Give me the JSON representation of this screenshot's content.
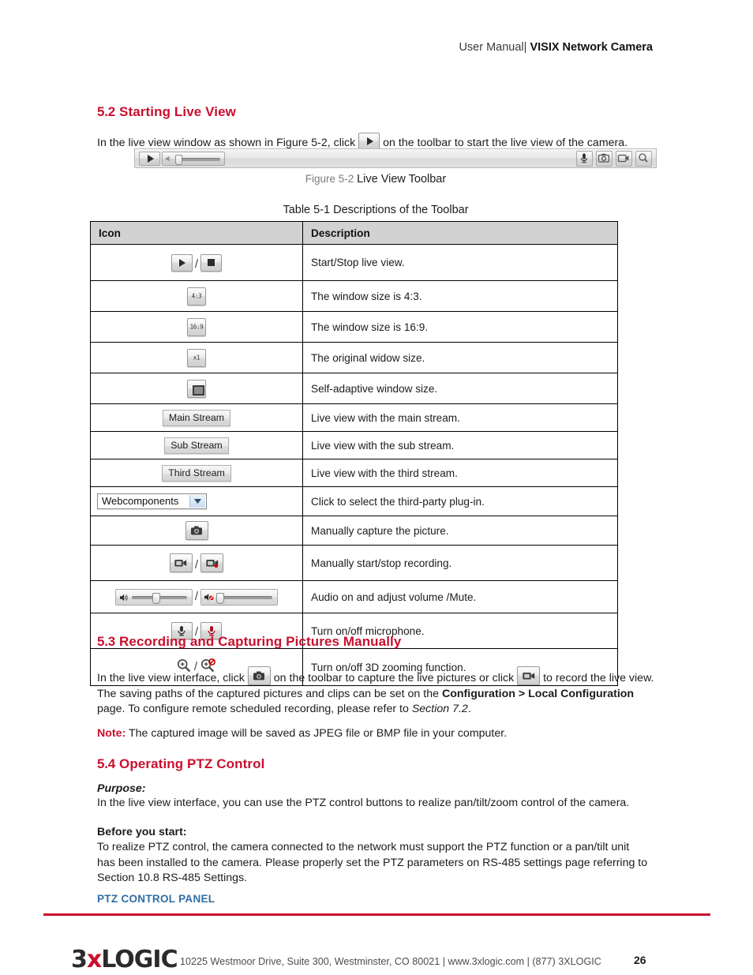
{
  "header": {
    "prefix": "User Manual|",
    "title": "VISIX Network Camera"
  },
  "sections": {
    "s52": {
      "num": "5.2",
      "title": "Starting Live View"
    },
    "s53": {
      "num": "5.3",
      "title": "Recording and Capturing Pictures Manually"
    },
    "s54": {
      "num": "5.4",
      "title": "Operating PTZ Control"
    }
  },
  "intro": {
    "part1": "In the live view window as shown in Figure 5-2, click",
    "part2": "on the toolbar to start the live view of the camera."
  },
  "figure": {
    "label": "Figure 5-2",
    "caption": "Live View Toolbar"
  },
  "table_caption": "Table 5-1 Descriptions of the Toolbar",
  "table": {
    "headers": [
      "Icon",
      "Description"
    ],
    "rows": [
      {
        "icon_kind": "play-stop",
        "icon_text": "",
        "desc": "Start/Stop live view."
      },
      {
        "icon_kind": "ratio",
        "icon_text": "4:3",
        "desc": "The window size is 4:3."
      },
      {
        "icon_kind": "ratio",
        "icon_text": "16:9",
        "desc": "The window size is 16:9."
      },
      {
        "icon_kind": "ratio",
        "icon_text": "x1",
        "desc": "The original widow size."
      },
      {
        "icon_kind": "self-adaptive",
        "icon_text": "",
        "desc": "Self-adaptive window size."
      },
      {
        "icon_kind": "pill",
        "icon_text": "Main Stream",
        "desc": "Live view with the main stream."
      },
      {
        "icon_kind": "pill",
        "icon_text": "Sub Stream",
        "desc": "Live view with the sub stream."
      },
      {
        "icon_kind": "pill",
        "icon_text": "Third Stream",
        "desc": "Live view with the third stream."
      },
      {
        "icon_kind": "dropdown",
        "icon_text": "Webcomponents",
        "desc": "Click to select the third-party plug-in."
      },
      {
        "icon_kind": "capture",
        "icon_text": "",
        "desc": "Manually capture the picture."
      },
      {
        "icon_kind": "record",
        "icon_text": "",
        "desc": "Manually start/stop recording."
      },
      {
        "icon_kind": "audio",
        "icon_text": "",
        "desc": "Audio on and adjust volume /Mute."
      },
      {
        "icon_kind": "mic",
        "icon_text": "",
        "desc": "Turn on/off microphone."
      },
      {
        "icon_kind": "zoom3d",
        "icon_text": "",
        "desc": "Turn on/off 3D zooming function."
      }
    ]
  },
  "s53_body": {
    "t1": "In the live view interface, click",
    "t2": "on the toolbar to capture the live pictures or click",
    "t3": "to record the live view. The saving paths of the captured pictures and clips can be set on the",
    "bold1": "Configuration > Local Configuration",
    "t4": "page. To configure remote scheduled recording, please refer to",
    "italic1": "Section 7.2",
    "t5": "."
  },
  "note": {
    "label": "Note:",
    "text": "The captured image will be saved as JPEG file or BMP file in your computer."
  },
  "s54_body": {
    "purpose_label": "Purpose:",
    "purpose_text": "In the live view interface, you can use the PTZ control buttons to realize pan/tilt/zoom control of the camera.",
    "before_label": "Before you start:",
    "before_text": "To realize PTZ control, the camera connected to the network must support the PTZ function or a pan/tilt unit has been installed to the camera. Please properly set the PTZ parameters on RS-485 settings page referring to Section 10.8 RS-485 Settings.",
    "panel_heading": "PTZ CONTROL PANEL"
  },
  "footer": {
    "logo_pre": "3",
    "logo_x": "x",
    "logo_post": "LOGIC",
    "address": "10225 Westmoor Drive, Suite 300, Westminster, CO 80021 | www.3xlogic.com | (877) 3XLOGIC",
    "page_number": "26"
  },
  "colors": {
    "accent_red": "#c8102e",
    "blue_heading": "#2f6ea5",
    "table_header_bg": "#d2d2d2"
  }
}
